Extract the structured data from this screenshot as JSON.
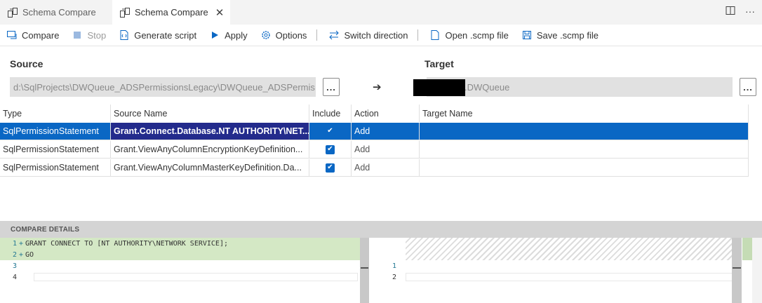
{
  "tabs": [
    {
      "label": "Schema Compare",
      "active": false
    },
    {
      "label": "Schema Compare",
      "active": true
    }
  ],
  "toolbar": {
    "compare": "Compare",
    "stop": "Stop",
    "generate_script": "Generate script",
    "apply": "Apply",
    "options": "Options",
    "switch_direction": "Switch direction",
    "open_scmp": "Open .scmp file",
    "save_scmp": "Save .scmp file"
  },
  "source": {
    "label": "Source",
    "path": "d:\\SqlProjects\\DWQueue_ADSPermissionsLegacy\\DWQueue_ADSPermis...",
    "ellipsis": "..."
  },
  "target": {
    "label": "Target",
    "value": ".DWQueue",
    "ellipsis": "..."
  },
  "arrow": "➔",
  "table": {
    "columns": [
      "Type",
      "Source Name",
      "Include",
      "Action",
      "Target Name"
    ],
    "rows": [
      {
        "type": "SqlPermissionStatement",
        "source_name": "Grant.Connect.Database.NT AUTHORITY\\NET...",
        "include": true,
        "action": "Add",
        "target_name": "",
        "selected": true
      },
      {
        "type": "SqlPermissionStatement",
        "source_name": "Grant.ViewAnyColumnEncryptionKeyDefinition...",
        "include": true,
        "action": "Add",
        "target_name": "",
        "selected": false
      },
      {
        "type": "SqlPermissionStatement",
        "source_name": "Grant.ViewAnyColumnMasterKeyDefinition.Da...",
        "include": true,
        "action": "Add",
        "target_name": "",
        "selected": false
      }
    ]
  },
  "details": {
    "title": "COMPARE DETAILS",
    "left_lines": [
      {
        "num": "1",
        "marker": "+",
        "text": "GRANT CONNECT TO [NT AUTHORITY\\NETWORK SERVICE];",
        "added": true
      },
      {
        "num": "2",
        "marker": "+",
        "text": "GO",
        "added": true
      },
      {
        "num": "3",
        "marker": "",
        "text": "",
        "added": false
      },
      {
        "num": "4",
        "marker": "",
        "text": "",
        "added": false
      }
    ],
    "right_lines": [
      {
        "num": "1"
      },
      {
        "num": "2"
      }
    ]
  },
  "colors": {
    "selected_row": "#0a67c4",
    "selected_cell": "#232b8c",
    "added_line": "#d4e8c5",
    "line_number": "#237893"
  }
}
